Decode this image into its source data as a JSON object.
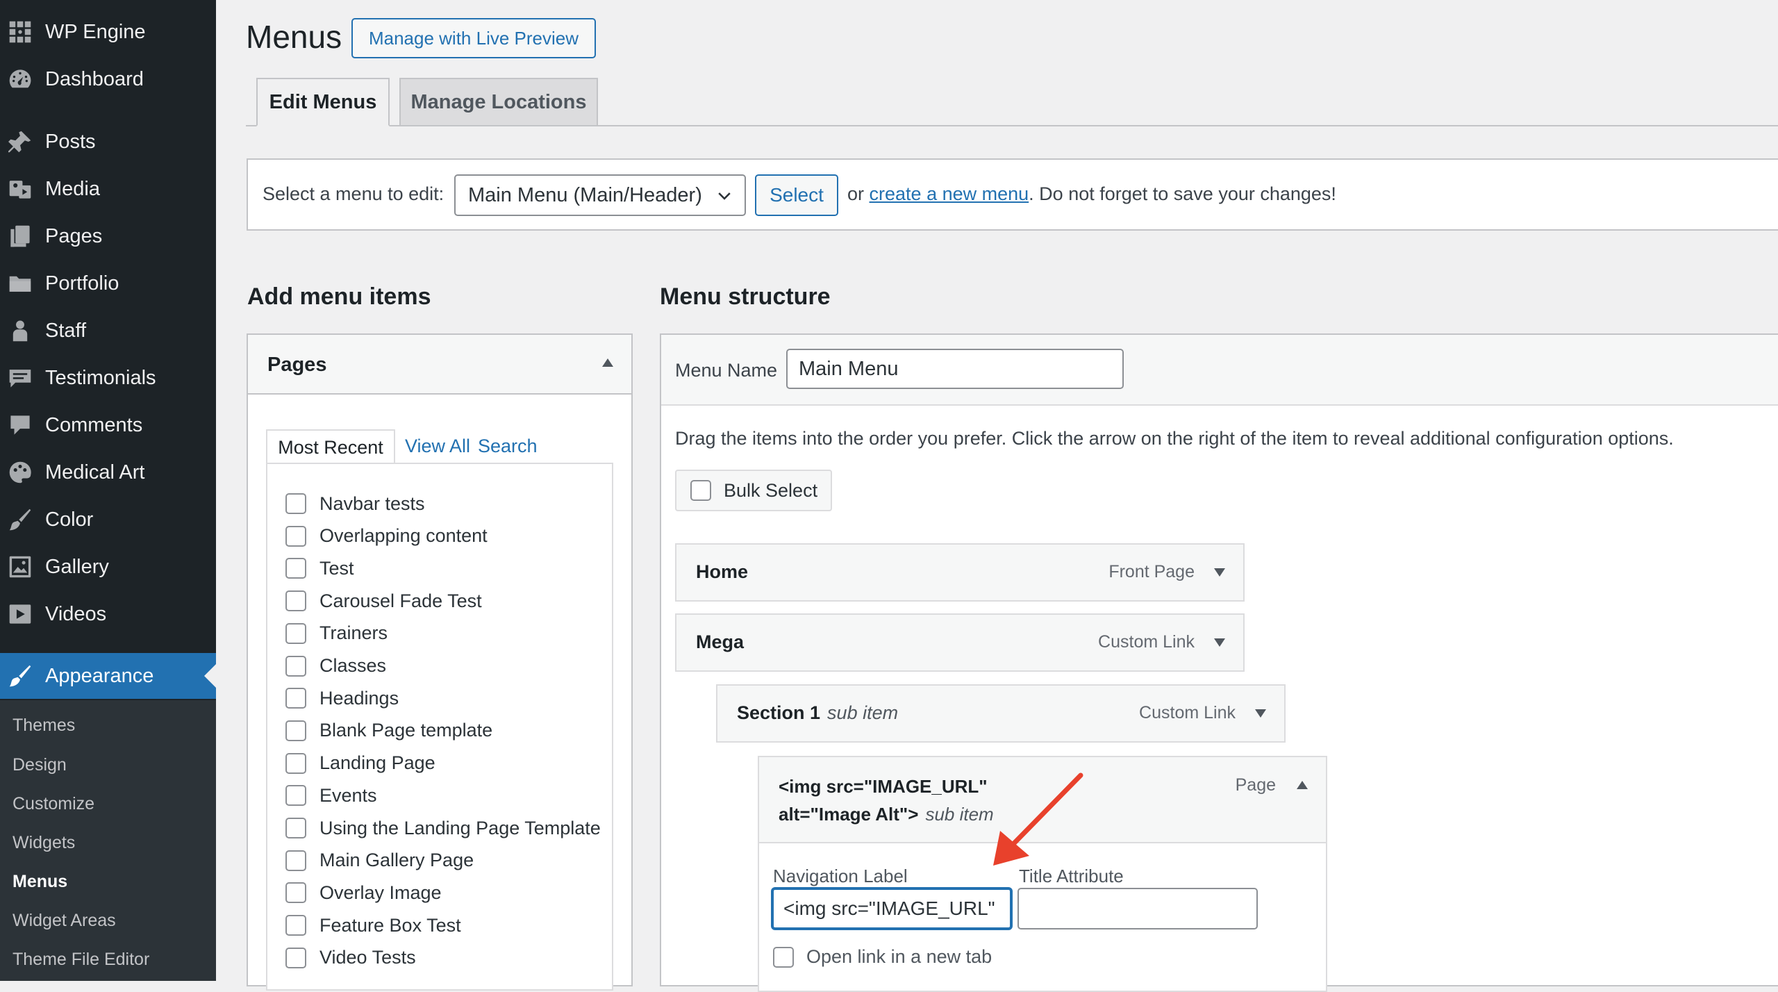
{
  "sidebar": {
    "items": [
      {
        "label": "WP Engine",
        "icon": "wp-engine-icon"
      },
      {
        "label": "Dashboard",
        "icon": "dashboard-icon"
      },
      {
        "label": "Posts",
        "icon": "pin-icon"
      },
      {
        "label": "Media",
        "icon": "media-icon"
      },
      {
        "label": "Pages",
        "icon": "pages-icon"
      },
      {
        "label": "Portfolio",
        "icon": "folder-icon"
      },
      {
        "label": "Staff",
        "icon": "person-icon"
      },
      {
        "label": "Testimonials",
        "icon": "testimonial-icon"
      },
      {
        "label": "Comments",
        "icon": "comment-icon"
      },
      {
        "label": "Medical Art",
        "icon": "palette-icon"
      },
      {
        "label": "Color",
        "icon": "brush-icon"
      },
      {
        "label": "Gallery",
        "icon": "gallery-icon"
      },
      {
        "label": "Videos",
        "icon": "video-icon"
      },
      {
        "label": "Appearance",
        "icon": "appearance-brush-icon",
        "active": true
      }
    ],
    "submenu": [
      "Themes",
      "Design",
      "Customize",
      "Widgets",
      "Menus",
      "Widget Areas",
      "Theme File Editor"
    ],
    "current_submenu": "Menus"
  },
  "header": {
    "title": "Menus",
    "live_preview_label": "Manage with Live Preview",
    "tabs": [
      {
        "label": "Edit Menus",
        "active": true
      },
      {
        "label": "Manage Locations",
        "active": false
      }
    ]
  },
  "select_bar": {
    "label": "Select a menu to edit:",
    "selected_menu": "Main Menu (Main/Header)",
    "select_button": "Select",
    "or_text": "or",
    "create_link": "create a new menu",
    "reminder": ". Do not forget to save your changes!"
  },
  "add_items": {
    "heading": "Add menu items",
    "box_title": "Pages",
    "tabs": [
      "Most Recent",
      "View All",
      "Search"
    ],
    "pages": [
      "Navbar tests",
      "Overlapping content",
      "Test",
      "Carousel Fade Test",
      "Trainers",
      "Classes",
      "Headings",
      "Blank Page template",
      "Landing Page",
      "Events",
      "Using the Landing Page Template",
      "Main Gallery Page",
      "Overlay Image",
      "Feature Box Test",
      "Video Tests"
    ]
  },
  "structure": {
    "heading": "Menu structure",
    "name_label": "Menu Name",
    "menu_name": "Main Menu",
    "instructions": "Drag the items into the order you prefer. Click the arrow on the right of the item to reveal additional configuration options.",
    "bulk_select": "Bulk Select",
    "items": [
      {
        "title": "Home",
        "type": "Front Page"
      },
      {
        "title": "Mega",
        "type": "Custom Link"
      },
      {
        "title": "Section 1",
        "sub": "sub item",
        "type": "Custom Link"
      }
    ],
    "expanded_item": {
      "title_line1": "<img src=\"IMAGE_URL\"",
      "title_line2": "alt=\"Image Alt\">",
      "sub": "sub item",
      "type": "Page",
      "nav_label": "Navigation Label",
      "nav_value": "<img src=\"IMAGE_URL\"",
      "title_attr_label": "Title Attribute",
      "title_attr_value": "",
      "new_tab_label": "Open link in a new tab"
    }
  },
  "colors": {
    "sidebar_bg": "#1d2327",
    "accent": "#2271b1",
    "annotation_arrow": "#e8412c"
  }
}
